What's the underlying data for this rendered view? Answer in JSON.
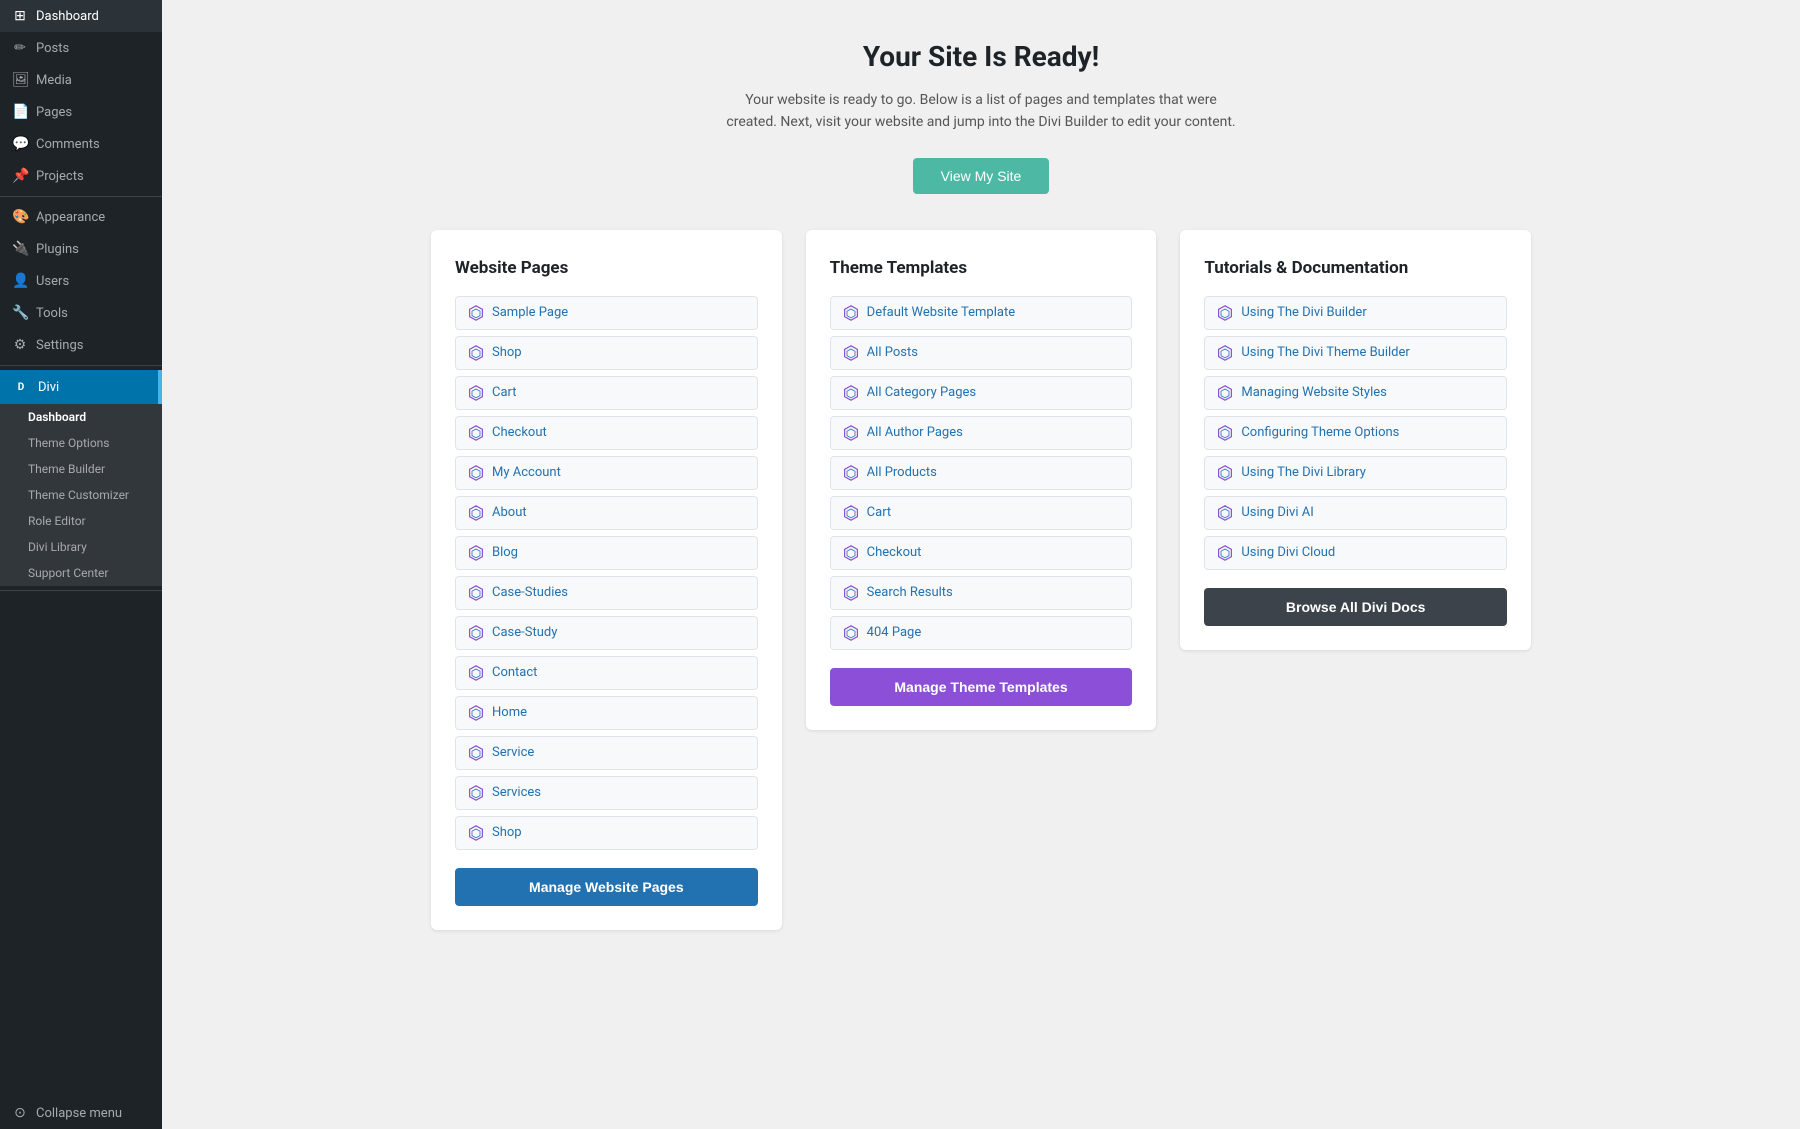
{
  "sidebar": {
    "items": [
      {
        "id": "dashboard",
        "label": "Dashboard",
        "icon": "⊞"
      },
      {
        "id": "posts",
        "label": "Posts",
        "icon": "📝"
      },
      {
        "id": "media",
        "label": "Media",
        "icon": "🖼"
      },
      {
        "id": "pages",
        "label": "Pages",
        "icon": "📄"
      },
      {
        "id": "comments",
        "label": "Comments",
        "icon": "💬"
      },
      {
        "id": "projects",
        "label": "Projects",
        "icon": "📌"
      },
      {
        "id": "appearance",
        "label": "Appearance",
        "icon": "🎨"
      },
      {
        "id": "plugins",
        "label": "Plugins",
        "icon": "🔌"
      },
      {
        "id": "users",
        "label": "Users",
        "icon": "👤"
      },
      {
        "id": "tools",
        "label": "Tools",
        "icon": "🔧"
      },
      {
        "id": "settings",
        "label": "Settings",
        "icon": "⚙"
      }
    ],
    "divi_label": "Divi",
    "submenu": [
      {
        "id": "dashboard-sub",
        "label": "Dashboard",
        "active": true
      },
      {
        "id": "theme-options",
        "label": "Theme Options"
      },
      {
        "id": "theme-builder",
        "label": "Theme Builder"
      },
      {
        "id": "theme-customizer",
        "label": "Theme Customizer"
      },
      {
        "id": "role-editor",
        "label": "Role Editor"
      },
      {
        "id": "divi-library",
        "label": "Divi Library"
      },
      {
        "id": "support-center",
        "label": "Support Center"
      }
    ],
    "collapse_label": "Collapse menu"
  },
  "main": {
    "title": "Your Site Is Ready!",
    "subtitle": "Your website is ready to go. Below is a list of pages and templates that were created. Next, visit your website and jump into the Divi Builder to edit your content.",
    "view_site_btn": "View My Site",
    "cards": {
      "website_pages": {
        "title": "Website Pages",
        "items": [
          "Sample Page",
          "Shop",
          "Cart",
          "Checkout",
          "My Account",
          "About",
          "Blog",
          "Case-Studies",
          "Case-Study",
          "Contact",
          "Home",
          "Service",
          "Services",
          "Shop"
        ],
        "btn_label": "Manage Website Pages"
      },
      "theme_templates": {
        "title": "Theme Templates",
        "items": [
          "Default Website Template",
          "All Posts",
          "All Category Pages",
          "All Author Pages",
          "All Products",
          "Cart",
          "Checkout",
          "Search Results",
          "404 Page"
        ],
        "btn_label": "Manage Theme Templates"
      },
      "tutorials": {
        "title": "Tutorials & Documentation",
        "items": [
          "Using The Divi Builder",
          "Using The Divi Theme Builder",
          "Managing Website Styles",
          "Configuring Theme Options",
          "Using The Divi Library",
          "Using Divi AI",
          "Using Divi Cloud"
        ],
        "btn_label": "Browse All Divi Docs"
      }
    }
  }
}
